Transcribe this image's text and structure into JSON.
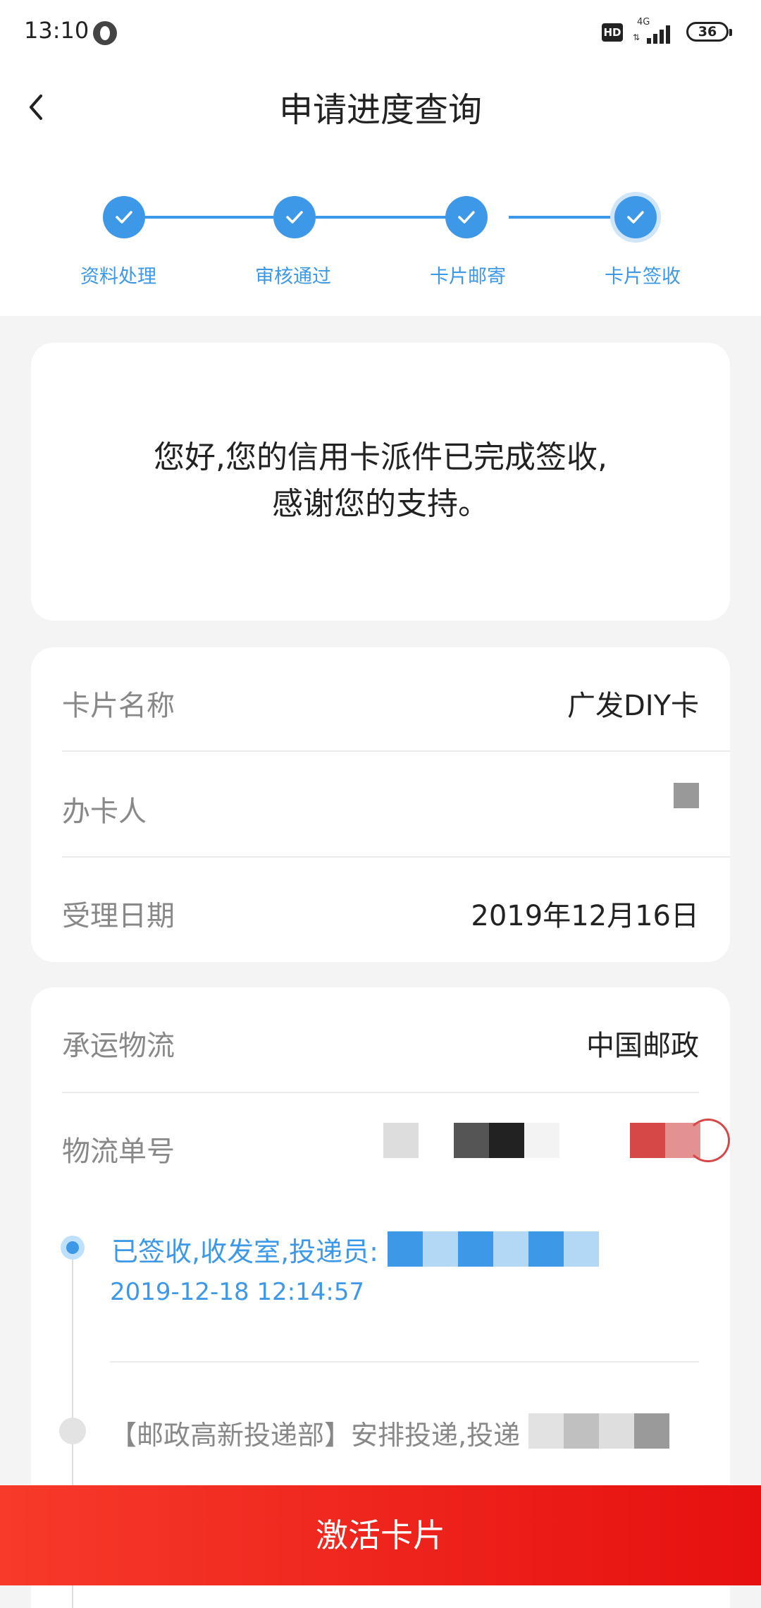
{
  "status_bar": {
    "time": "13:10",
    "hd": "HD",
    "network": "4G",
    "battery": "36"
  },
  "header": {
    "title": "申请进度查询",
    "back_icon": "chevron-left-icon"
  },
  "steps": [
    {
      "label": "资料处理",
      "done": true
    },
    {
      "label": "审核通过",
      "done": true
    },
    {
      "label": "卡片邮寄",
      "done": true
    },
    {
      "label": "卡片签收",
      "done": true,
      "current": true
    }
  ],
  "notice": {
    "message": "您好,您的信用卡派件已完成签收,感谢您的支持。"
  },
  "card_info": {
    "card_name_label": "卡片名称",
    "card_name_value": "广发DIY卡",
    "applicant_label": "办卡人",
    "accept_date_label": "受理日期",
    "accept_date_value": "2019年12月16日"
  },
  "logistics": {
    "carrier_label": "承运物流",
    "carrier_value": "中国邮政",
    "tracking_label": "物流单号",
    "events": [
      {
        "text": "已签收,收发室,投递员:",
        "time": "2019-12-18 12:14:57"
      },
      {
        "text": "【邮政高新投递部】安排投递,投递"
      }
    ]
  },
  "actions": {
    "activate_label": "激活卡片"
  },
  "colors": {
    "accent_blue": "#3e98e8",
    "button_red": "#e61010",
    "background": "#f4f4f4"
  }
}
